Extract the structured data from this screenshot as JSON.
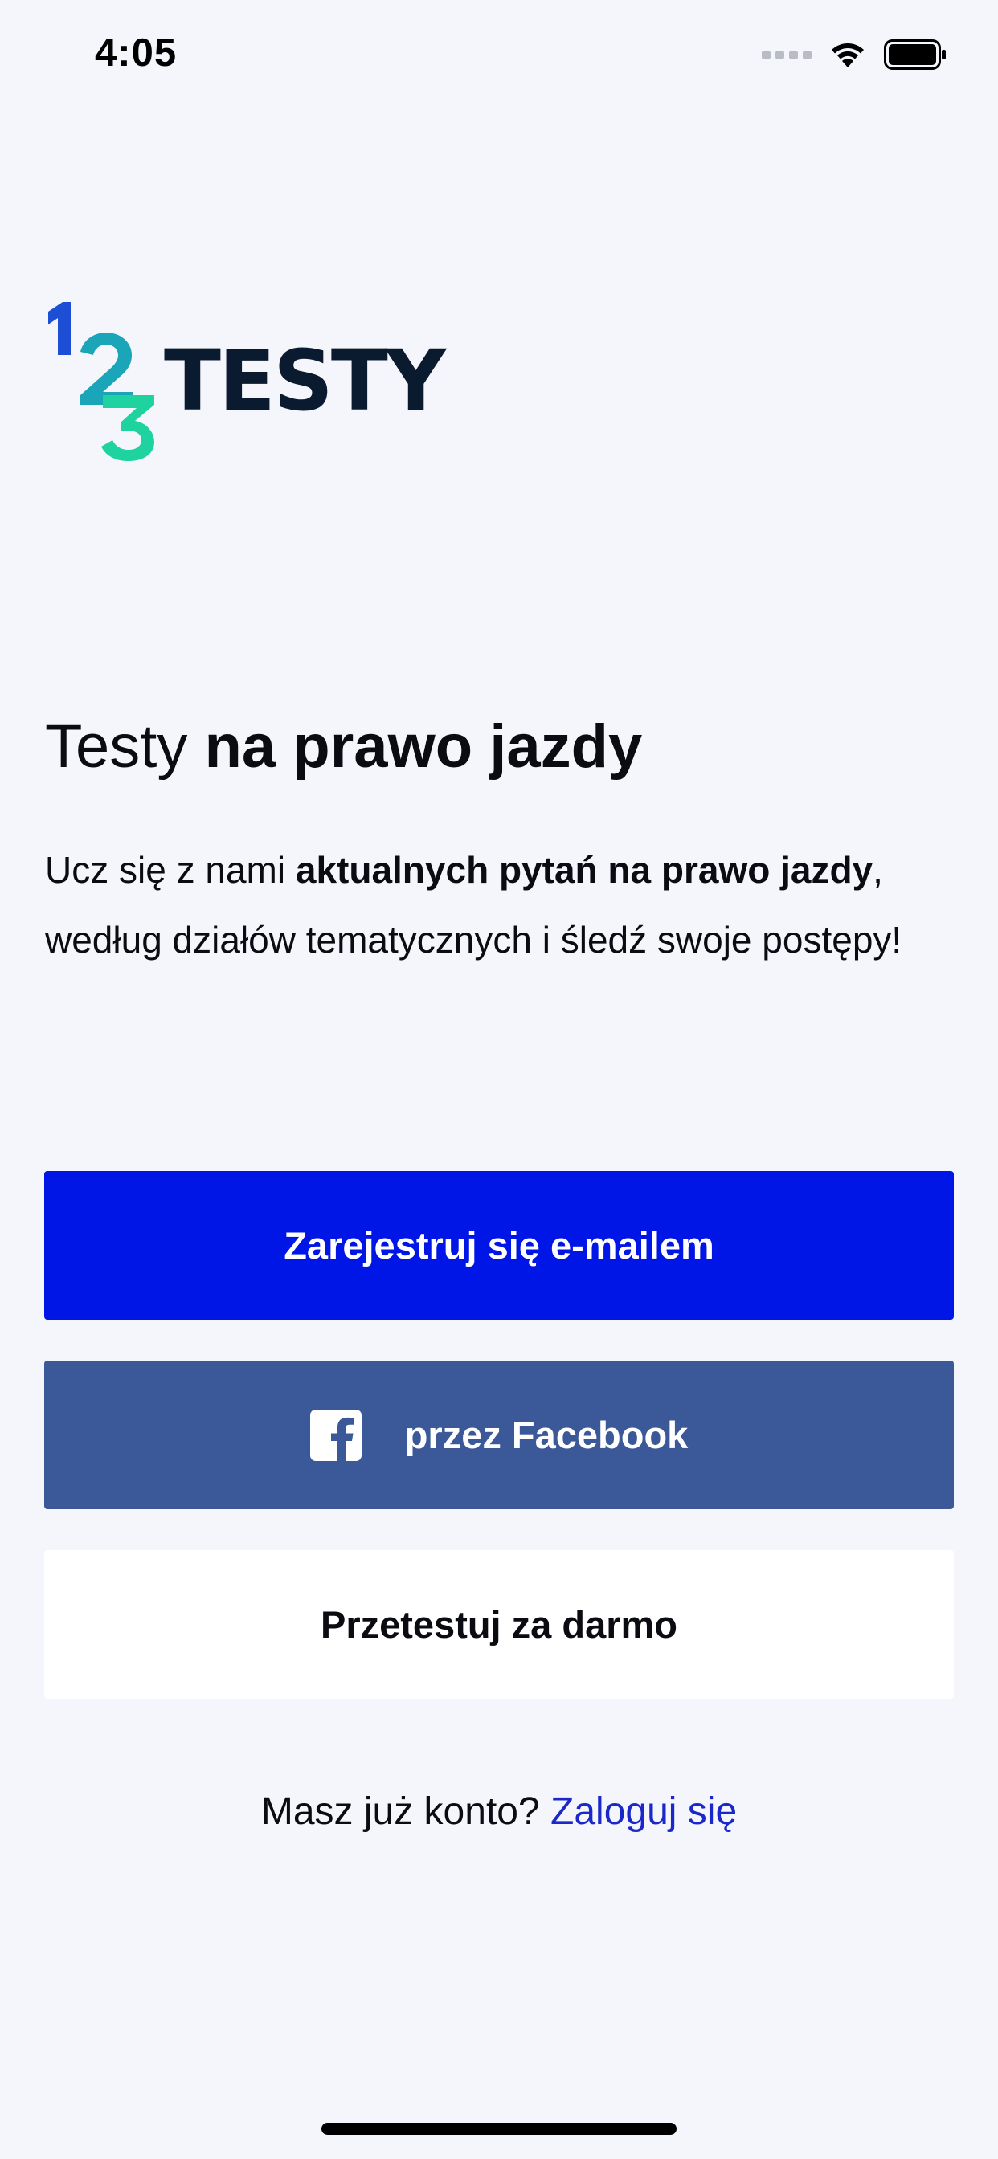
{
  "status_bar": {
    "time": "4:05",
    "icons": [
      "signal-icon",
      "wifi-icon",
      "battery-icon"
    ]
  },
  "logo": {
    "digits": [
      "1",
      "2",
      "3"
    ],
    "word": "TESTY",
    "colors": {
      "digit_1": "#1c4fd6",
      "digit_2": "#1aa6b8",
      "digit_3": "#1ed3a0",
      "word": "#0a1a2f"
    }
  },
  "headline": {
    "light": "Testy ",
    "bold": "na prawo jazdy"
  },
  "lead": {
    "intro": "Ucz się z nami ",
    "bold": "aktualnych pytań na prawo jazdy",
    "rest": ", według działów tematycznych i śledź swoje postępy!"
  },
  "buttons": {
    "email": "Zarejestruj się e-mailem",
    "facebook": "przez Facebook",
    "facebook_icon": "facebook-icon",
    "free": "Przetestuj za darmo"
  },
  "login": {
    "prompt": "Masz już konto? ",
    "link": "Zaloguj się"
  },
  "colors": {
    "background": "#f5f6fc",
    "primary": "#0016e6",
    "facebook": "#3b5998",
    "link": "#1a28c9"
  }
}
